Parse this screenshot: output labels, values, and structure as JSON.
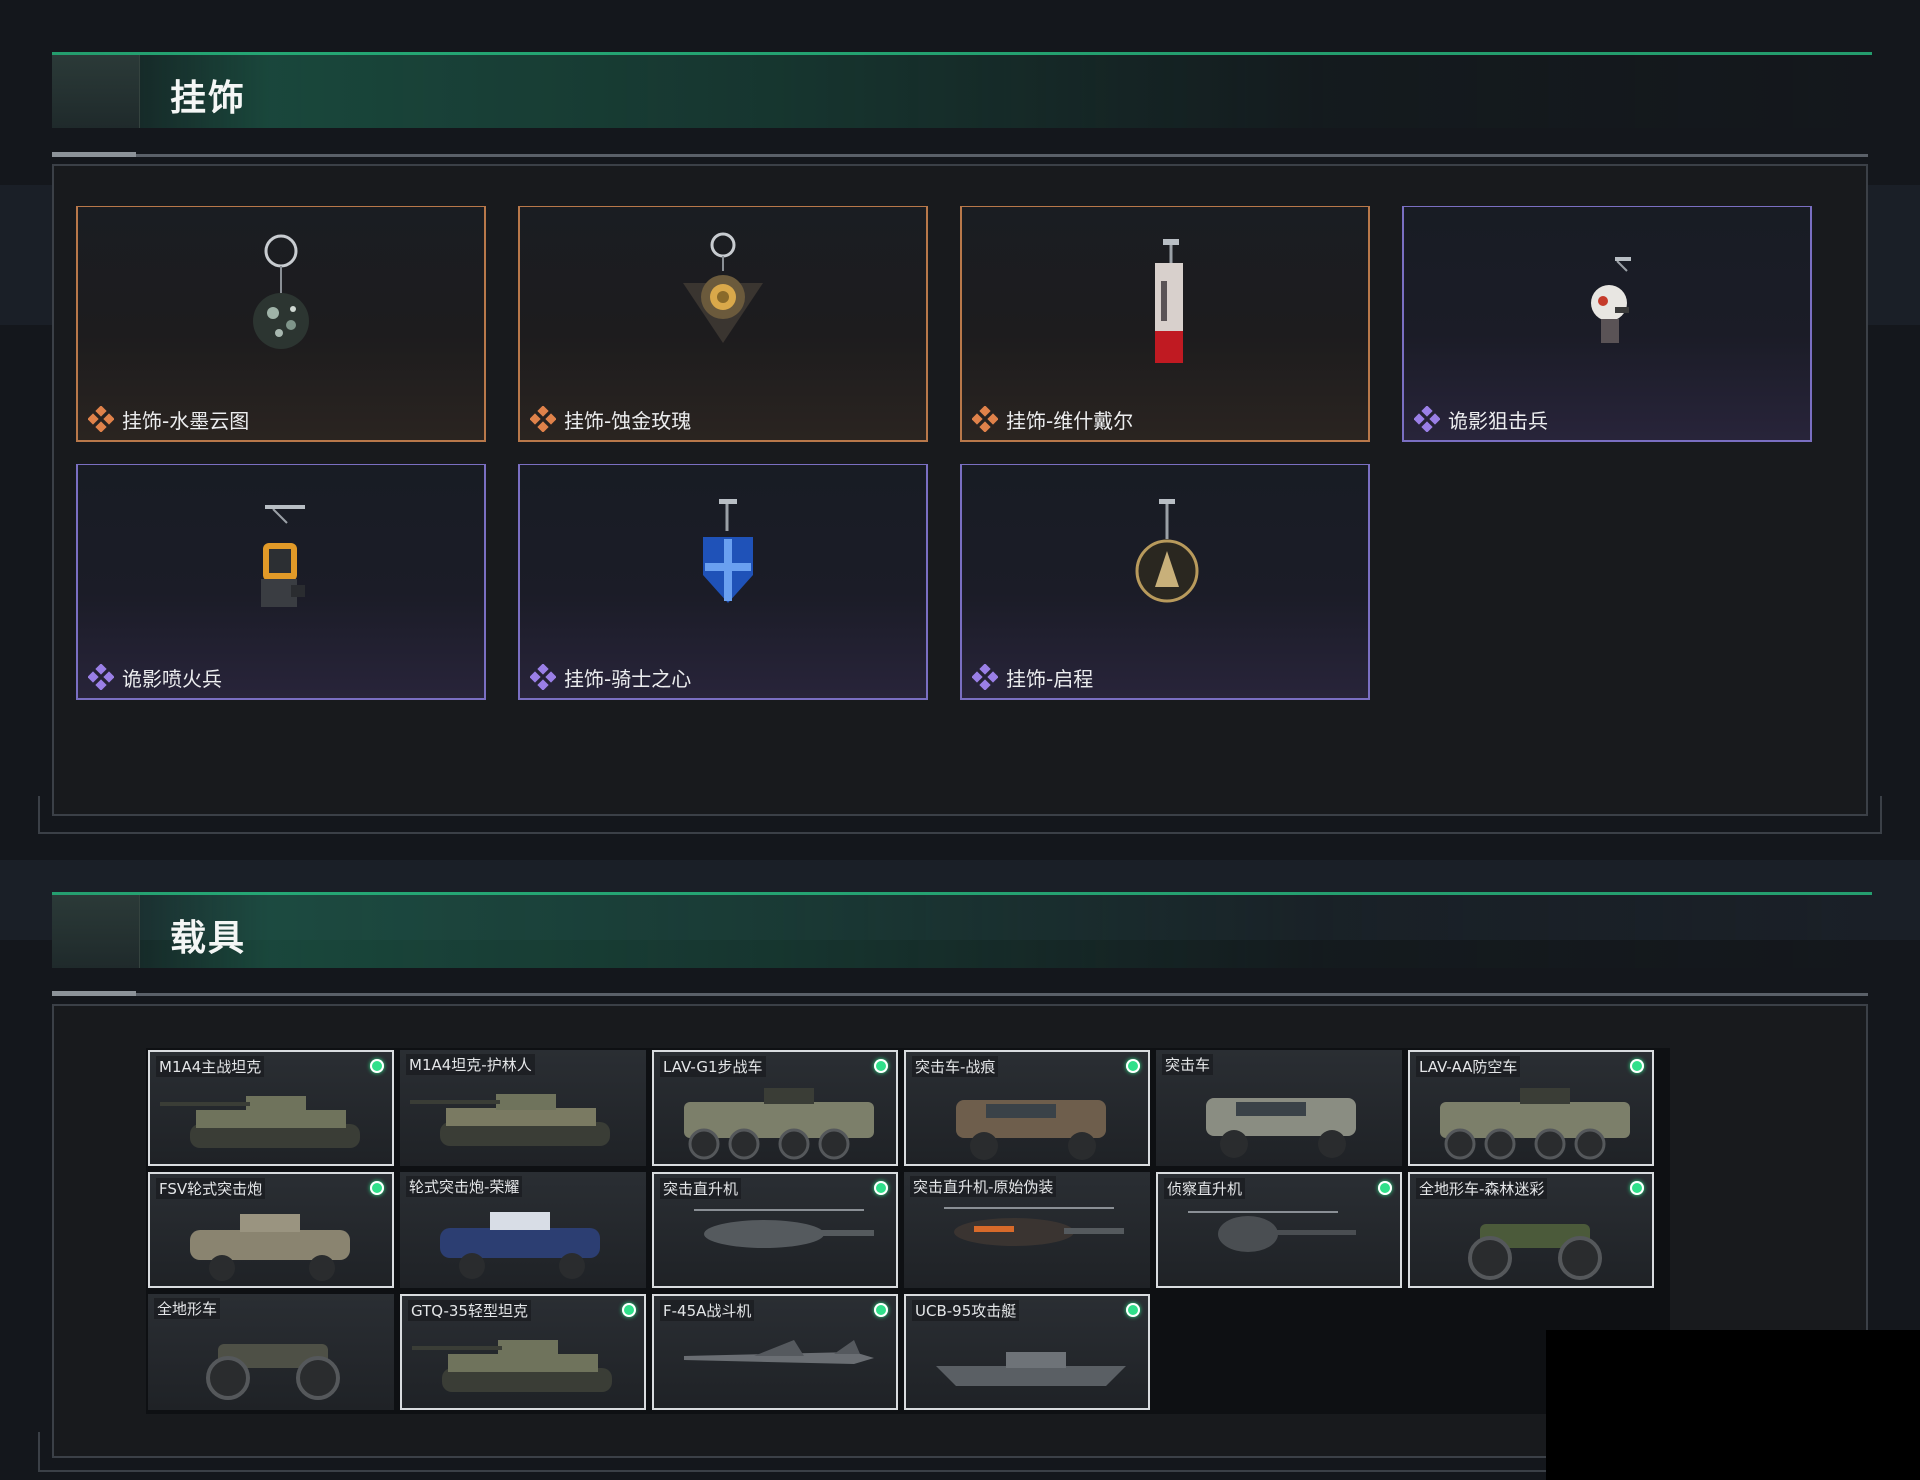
{
  "sections": {
    "charms_title": "挂饰",
    "vehicles_title": "载具"
  },
  "charms": [
    {
      "label": "挂饰-水墨云图",
      "rarity": "orange",
      "icon": "ink-cloud-sphere-charm-icon"
    },
    {
      "label": "挂饰-蚀金玫瑰",
      "rarity": "orange",
      "icon": "golden-rose-charm-icon"
    },
    {
      "label": "挂饰-维什戴尔",
      "rarity": "orange",
      "icon": "weishdale-tag-charm-icon"
    },
    {
      "label": "诡影狙击兵",
      "rarity": "purple",
      "icon": "shadow-sniper-figure-charm-icon"
    },
    {
      "label": "诡影喷火兵",
      "rarity": "purple",
      "icon": "shadow-flamethrower-figure-charm-icon"
    },
    {
      "label": "挂饰-骑士之心",
      "rarity": "purple",
      "icon": "knight-heart-shield-charm-icon"
    },
    {
      "label": "挂饰-启程",
      "rarity": "purple",
      "icon": "departure-medal-charm-icon"
    }
  ],
  "rarity_colors": {
    "orange": "#e0824a",
    "purple": "#9a7fe6"
  },
  "vehicles": [
    {
      "name": "M1A4主战坦克",
      "framed": true,
      "owned": true,
      "kind": "tank"
    },
    {
      "name": "M1A4坦克-护林人",
      "framed": false,
      "owned": false,
      "kind": "tank-camo"
    },
    {
      "name": "LAV-G1步战车",
      "framed": true,
      "owned": true,
      "kind": "apc8"
    },
    {
      "name": "突击车-战痕",
      "framed": true,
      "owned": true,
      "kind": "assault-car-scar"
    },
    {
      "name": "突击车",
      "framed": false,
      "owned": false,
      "kind": "assault-car"
    },
    {
      "name": "LAV-AA防空车",
      "framed": true,
      "owned": true,
      "kind": "apc8-aa"
    },
    {
      "name": "FSV轮式突击炮",
      "framed": true,
      "owned": true,
      "kind": "wheeled-gun"
    },
    {
      "name": "轮式突击炮-荣耀",
      "framed": false,
      "owned": false,
      "kind": "wheeled-gun-glory"
    },
    {
      "name": "突击直升机",
      "framed": true,
      "owned": true,
      "kind": "attack-heli"
    },
    {
      "name": "突击直升机-原始伪装",
      "framed": false,
      "owned": false,
      "kind": "attack-heli-camo"
    },
    {
      "name": "侦察直升机",
      "framed": true,
      "owned": true,
      "kind": "scout-heli"
    },
    {
      "name": "全地形车-森林迷彩",
      "framed": true,
      "owned": true,
      "kind": "atv-camo"
    },
    {
      "name": "全地形车",
      "framed": false,
      "owned": false,
      "kind": "atv"
    },
    {
      "name": "GTQ-35轻型坦克",
      "framed": true,
      "owned": true,
      "kind": "light-tank"
    },
    {
      "name": "F-45A战斗机",
      "framed": true,
      "owned": true,
      "kind": "jet"
    },
    {
      "name": "UCB-95攻击艇",
      "framed": true,
      "owned": true,
      "kind": "boat"
    }
  ]
}
